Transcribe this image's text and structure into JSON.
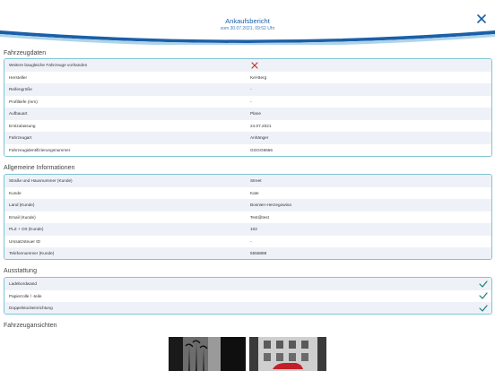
{
  "header": {
    "title": "Ankaufsbericht",
    "subtitle": "vom 30.07.2021, 09:52 Uhr",
    "close_icon": "close-icon",
    "accent": "#1b5fa8"
  },
  "sections": {
    "vehicle": {
      "title": "Fahrzeugdaten",
      "rows": [
        {
          "label": "Weitere baugleiche Fahrzeuge vorhanden",
          "value": ""
        },
        {
          "label": "Hersteller",
          "value": "Kel-Berg"
        },
        {
          "label": "Reifengröße",
          "value": "-"
        },
        {
          "label": "Profiltiefe (mm)",
          "value": "-"
        },
        {
          "label": "Aufbauart",
          "value": "Plane"
        },
        {
          "label": "Erstzulassung",
          "value": "24.07.2021"
        },
        {
          "label": "Fahrzeugart",
          "value": "Anhänger"
        },
        {
          "label": "Fahrzeugidentifizierungsnummer",
          "value": "GGGG6666"
        }
      ],
      "first_row_icon": "x-mark-icon"
    },
    "general": {
      "title": "Allgemeine Informationen",
      "rows": [
        {
          "label": "Straße und Hausnummer (Kunde)",
          "value": "Street"
        },
        {
          "label": "Kunde",
          "value": "Kate"
        },
        {
          "label": "Land (Kunde)",
          "value": "Bosnien-Herzegowina"
        },
        {
          "label": "Email (Kunde)",
          "value": "Test@test"
        },
        {
          "label": "PLZ + Ort (Kunde)",
          "value": "102"
        },
        {
          "label": "Umsatzsteuer ID",
          "value": "-"
        },
        {
          "label": "Telefonnummer (Kunde)",
          "value": "5555888"
        }
      ]
    },
    "equipment": {
      "title": "Ausstattung",
      "items": [
        {
          "label": "Ladebordwand",
          "icon": "check-icon"
        },
        {
          "label": "Papierrolle / -teile",
          "icon": "check-icon"
        },
        {
          "label": "Doppelstockeinrichtung",
          "icon": "check-icon"
        }
      ]
    },
    "views": {
      "title": "Fahrzeugansichten",
      "photos": [
        "palm-street-photo",
        "red-car-building-photo"
      ]
    }
  },
  "colors": {
    "panel_border": "#7fc3d3",
    "row_stripe": "#eef2f8",
    "x_mark": "#c0392b",
    "check": "#1e7a72"
  }
}
